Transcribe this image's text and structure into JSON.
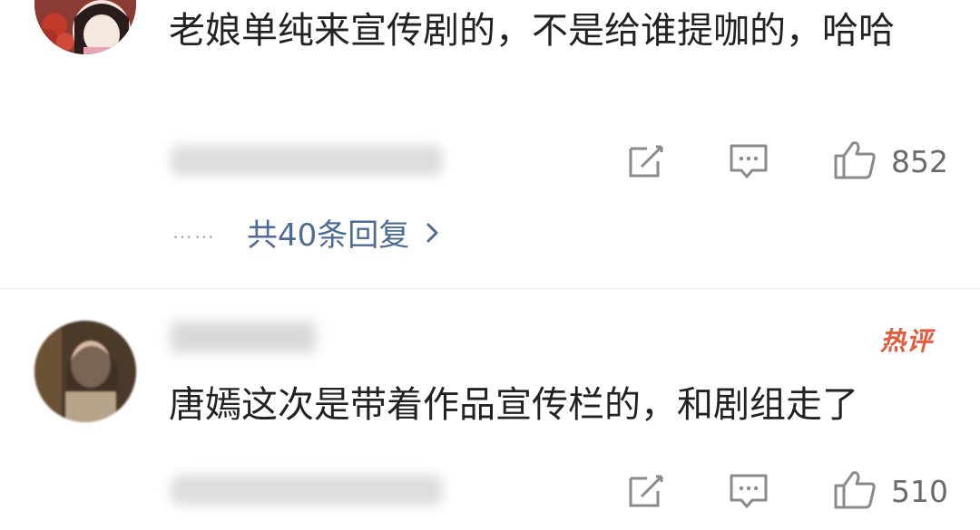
{
  "comments": [
    {
      "text": "老娘单纯来宣传剧的，不是给谁提咖的，哈哈",
      "likes": "852",
      "replies": "共40条回复",
      "dots": "……"
    },
    {
      "badge": "热评",
      "text": "唐嫣这次是带着作品宣传栏的，和剧组走了",
      "likes": "510"
    }
  ],
  "icons": {
    "share": "edit-share-icon",
    "reply": "comment-bubble-icon",
    "like": "thumbs-up-icon",
    "chevron": "chevron-right-icon"
  },
  "colors": {
    "link": "#4d6b94",
    "hot": "#e45a3a",
    "text": "#222222",
    "count": "#6a6a6a"
  }
}
